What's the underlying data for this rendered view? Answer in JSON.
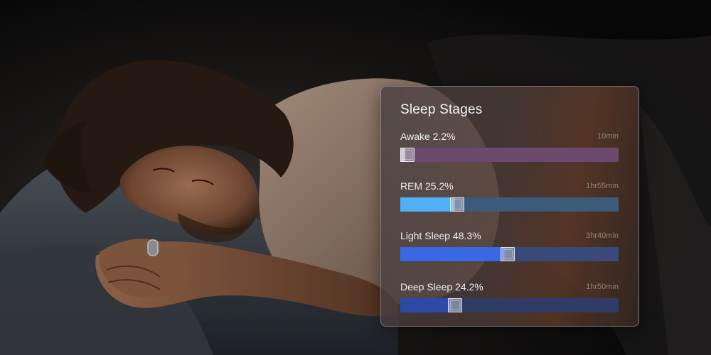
{
  "panel": {
    "title": "Sleep Stages",
    "stages": [
      {
        "label": "Awake 2.2%",
        "duration": "10min",
        "percent": 2.2,
        "color": "#d8d8de",
        "track_color": "#6b4a6e"
      },
      {
        "label": "REM 25.2%",
        "duration": "1hr55min",
        "percent": 25.2,
        "color": "#4fb0f5",
        "track_color": "#3c5a7a"
      },
      {
        "label": "Light Sleep 48.3%",
        "duration": "3hr40min",
        "percent": 48.3,
        "color": "#3a67e6",
        "track_color": "#3a4a78"
      },
      {
        "label": "Deep Sleep 24.2%",
        "duration": "1hr50min",
        "percent": 24.2,
        "color": "#2d4aa8",
        "track_color": "#2f3c66"
      }
    ]
  }
}
